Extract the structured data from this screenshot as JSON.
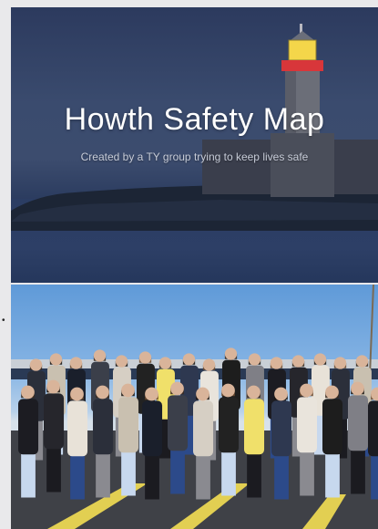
{
  "hero": {
    "title": "Howth Safety Map",
    "subtitle": "Created by a TY group trying to keep lives safe"
  },
  "list": {
    "bullet": "•"
  },
  "colors": {
    "hero_sky": "#2c3a5e",
    "lighthouse_lamp": "#f4d64a",
    "lighthouse_band": "#d8363a",
    "photo_sky": "#86b4e4",
    "road_line": "#e2cf52"
  },
  "icons": {
    "lighthouse": "lighthouse-illustration",
    "group": "group-photo-illustration"
  }
}
